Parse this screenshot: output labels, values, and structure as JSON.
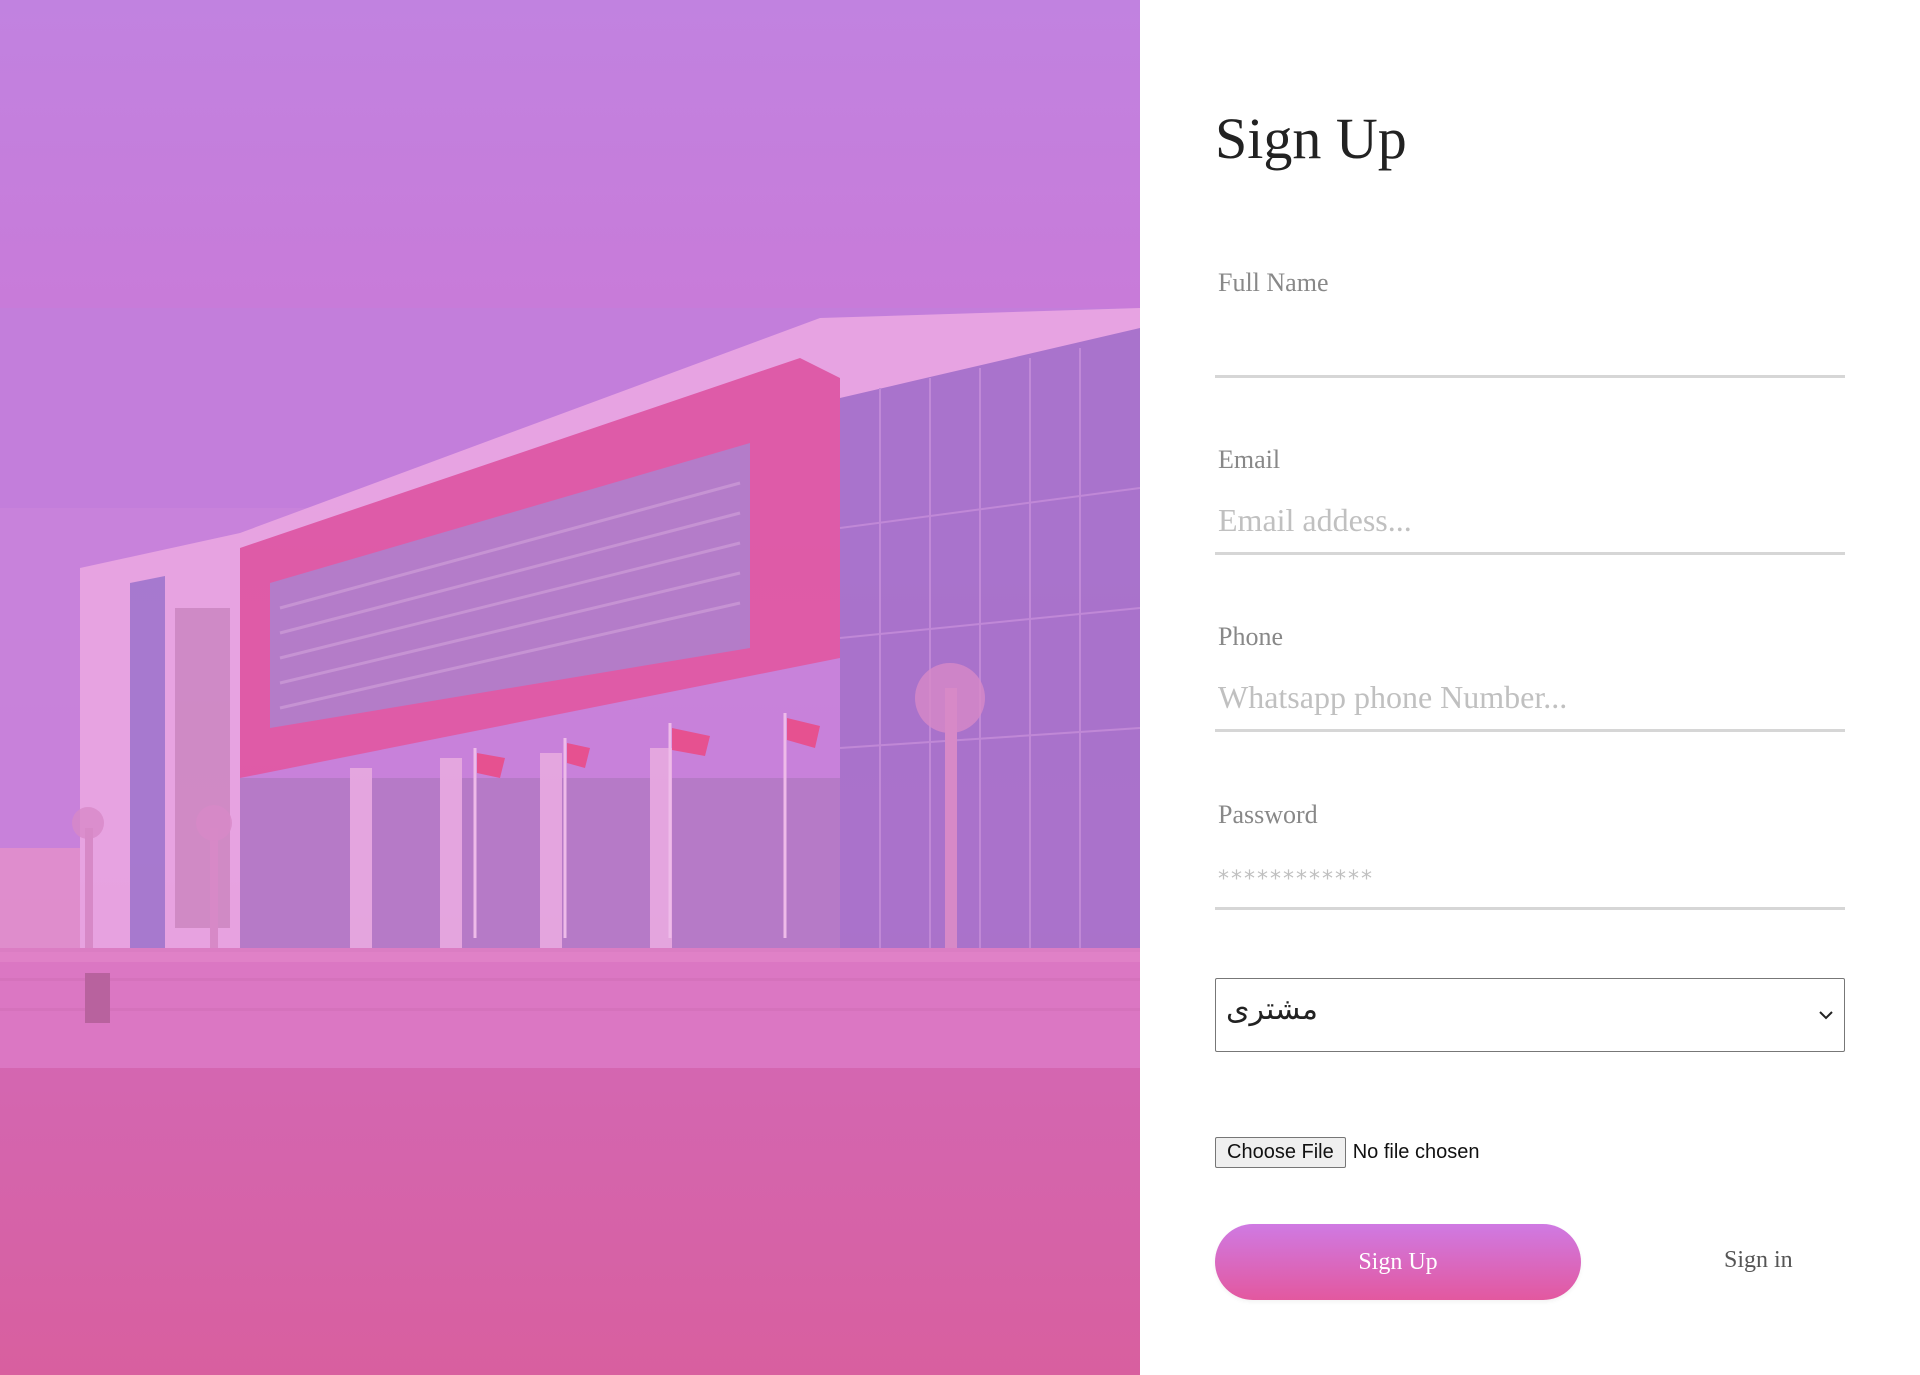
{
  "form": {
    "title": "Sign Up",
    "fields": {
      "full_name": {
        "label": "Full Name",
        "placeholder": ""
      },
      "email": {
        "label": "Email",
        "placeholder": "Email addess..."
      },
      "phone": {
        "label": "Phone",
        "placeholder": "Whatsapp phone Number..."
      },
      "password": {
        "label": "Password",
        "placeholder": "************"
      }
    },
    "role_select": {
      "selected": "مشترى"
    },
    "file_upload": {
      "button_label": "Choose File",
      "status": "No file chosen"
    },
    "signup_button": "Sign Up",
    "signin_link": "Sign in"
  },
  "colors": {
    "gradient_top": "#c182e0",
    "gradient_bottom": "#d85f9f",
    "button_top": "#cf7ae3",
    "button_bottom": "#e3589f"
  },
  "icons": {
    "select_chevron": "chevron-down-icon"
  }
}
